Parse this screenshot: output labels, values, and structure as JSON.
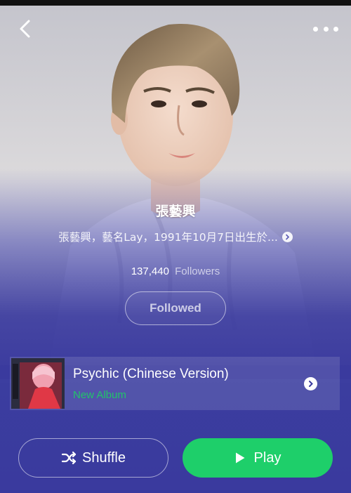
{
  "header": {
    "back_icon": "chevron-left-icon",
    "more_icon": "more-horizontal-icon"
  },
  "artist": {
    "name": "張藝興",
    "bio": "張藝興，藝名Lay，1991年10月7日出生於...",
    "followers_count": "137,440",
    "followers_label": "Followers",
    "follow_button_label": "Followed"
  },
  "latest_release": {
    "title": "Psychic (Chinese Version)",
    "subtitle": "New Album",
    "subtitle_color": "#22c46a"
  },
  "actions": {
    "shuffle_label": "Shuffle",
    "shuffle_icon": "shuffle-icon",
    "play_label": "Play",
    "play_icon": "play-icon",
    "play_color": "#1ecf6a"
  },
  "theme": {
    "background": "#3a3a9e"
  }
}
